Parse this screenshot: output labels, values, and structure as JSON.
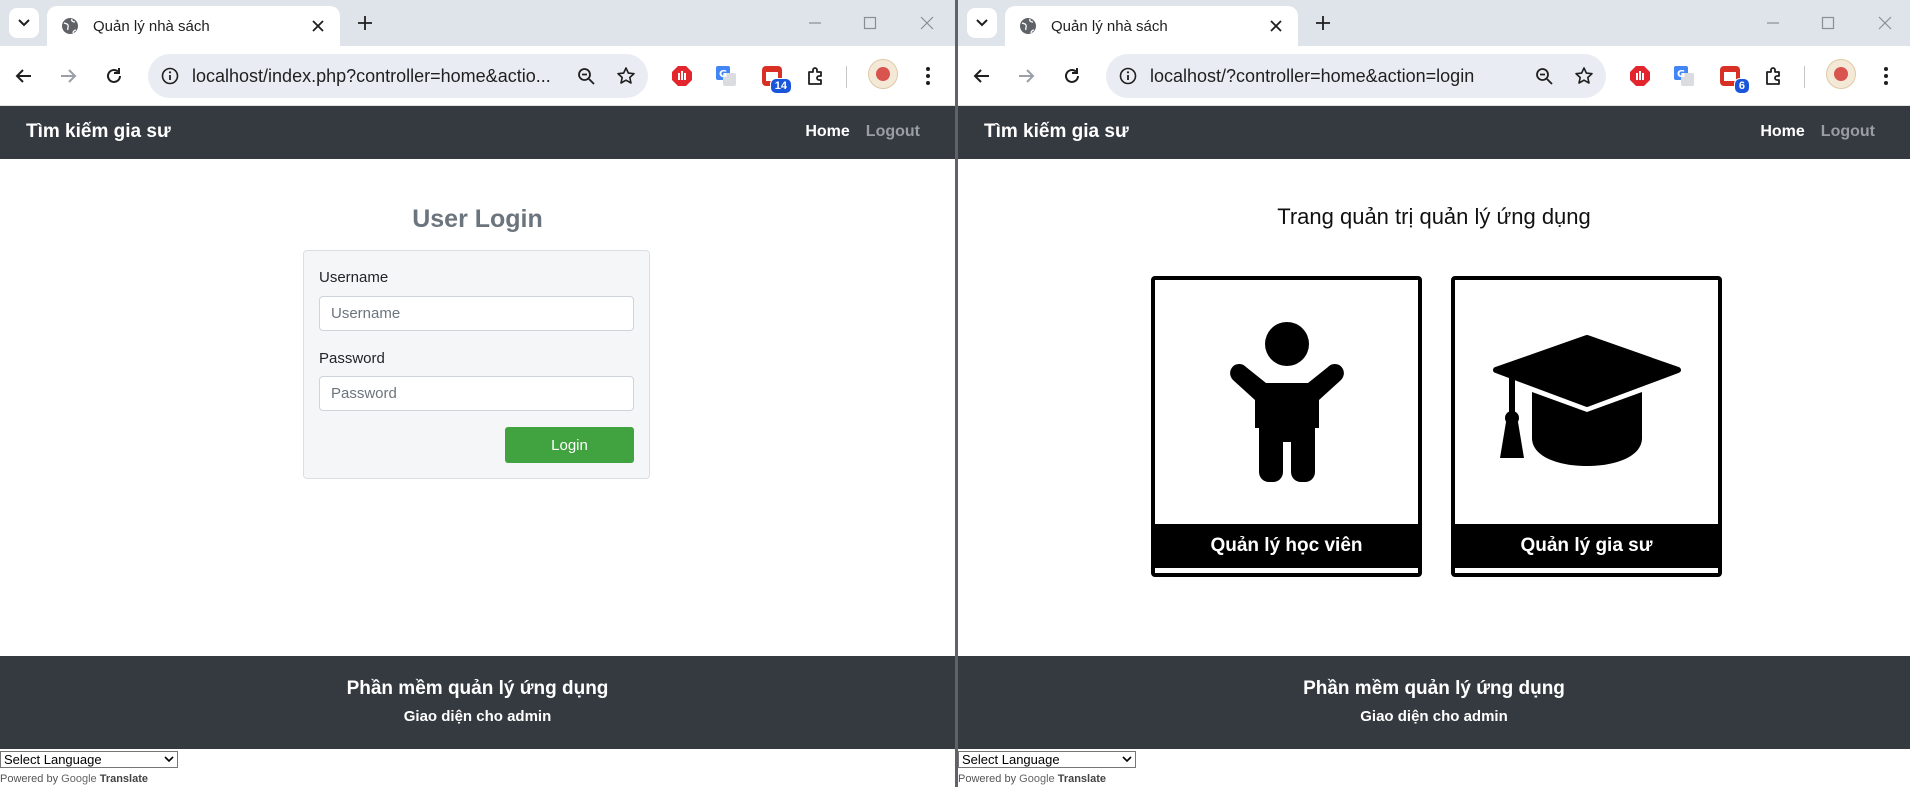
{
  "colors": {
    "tabstrip": "#dfe3ea",
    "navbar": "#343a40",
    "login_button": "#40a33f",
    "ext_badge": "#1a56db"
  },
  "left": {
    "tab": {
      "title": "Quản lý nhà sách",
      "icon": "globe-icon"
    },
    "url": "localhost/index.php?controller=home&actio...",
    "ext_badge": "14",
    "site": {
      "brand": "Tìm kiếm gia sư",
      "nav_home": "Home",
      "nav_logout": "Logout"
    },
    "login": {
      "title": "User Login",
      "username_label": "Username",
      "username_placeholder": "Username",
      "password_label": "Password",
      "password_placeholder": "Password",
      "button": "Login"
    },
    "footer": {
      "line1": "Phần mềm quản lý ứng dụng",
      "line2": "Giao diện cho admin"
    },
    "translate": {
      "select": "Select Language",
      "powered": "Powered by",
      "google": "Google",
      "translate": "Translate"
    }
  },
  "right": {
    "tab": {
      "title": "Quản lý nhà sách",
      "icon": "globe-icon"
    },
    "url": "localhost/?controller=home&action=login",
    "ext_badge": "6",
    "site": {
      "brand": "Tìm kiếm gia sư",
      "nav_home": "Home",
      "nav_logout": "Logout"
    },
    "admin": {
      "title": "Trang quản trị quản lý ứng dụng",
      "cards": [
        {
          "label": "Quản lý học viên",
          "icon": "child-icon"
        },
        {
          "label": "Quản lý gia sư",
          "icon": "graduation-cap-icon"
        }
      ]
    },
    "footer": {
      "line1": "Phần mềm quản lý ứng dụng",
      "line2": "Giao diện cho admin"
    },
    "translate": {
      "select": "Select Language",
      "powered": "Powered by",
      "google": "Google",
      "translate": "Translate"
    }
  }
}
